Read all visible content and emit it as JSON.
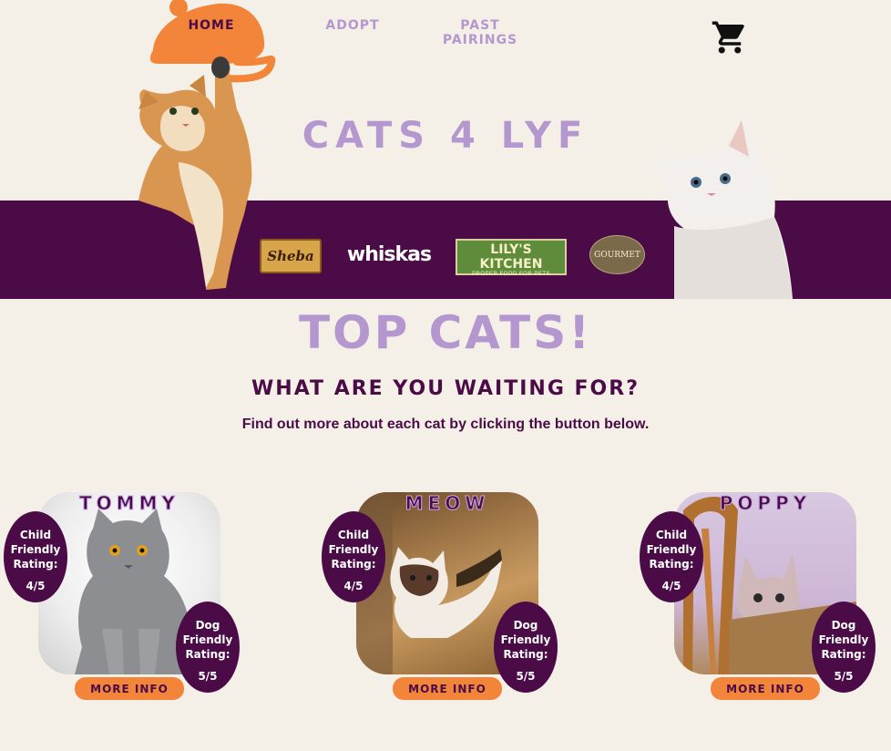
{
  "nav": {
    "home": "HOME",
    "adopt": "ADOPT",
    "past_pairings": "PAST PAIRINGS",
    "cart_icon": "shopping-cart-icon"
  },
  "hero": {
    "title": "CATS 4 LYF"
  },
  "brands": {
    "sheba": "Sheba",
    "whiskas": "whiskas",
    "lily_main": "LILY'S KITCHEN",
    "lily_tagline": "PROPER FOOD FOR PETS",
    "gourmet": "GOURMET"
  },
  "section": {
    "title": "TOP CATS!",
    "subtitle": "WHAT ARE YOU WAITING FOR?",
    "description": "Find out more about each cat by clicking the button below."
  },
  "cards": [
    {
      "name": "TOMMY",
      "child_label": "Child Friendly Rating:",
      "child_value": "4/5",
      "dog_label": "Dog Friendly Rating:",
      "dog_value": "5/5",
      "button": "MORE INFO"
    },
    {
      "name": "MEOW",
      "child_label": "Child Friendly Rating:",
      "child_value": "4/5",
      "dog_label": "Dog Friendly Rating:",
      "dog_value": "5/5",
      "button": "MORE INFO"
    },
    {
      "name": "POPPY",
      "child_label": "Child Friendly Rating:",
      "child_value": "4/5",
      "dog_label": "Dog Friendly Rating:",
      "dog_value": "5/5",
      "button": "MORE INFO"
    }
  ],
  "colors": {
    "background": "#f5f0e7",
    "purple_dark": "#4a0b47",
    "lavender": "#b497cf",
    "orange": "#f2853a"
  }
}
